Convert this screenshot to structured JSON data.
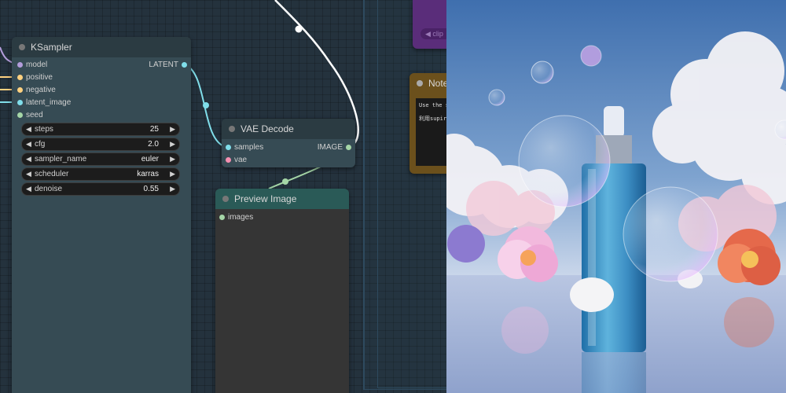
{
  "ksampler": {
    "title": "KSampler",
    "inputs": [
      "model",
      "positive",
      "negative",
      "latent_image",
      "seed"
    ],
    "output": "LATENT",
    "widgets": [
      {
        "label": "steps",
        "value": "25"
      },
      {
        "label": "cfg",
        "value": "2.0"
      },
      {
        "label": "sampler_name",
        "value": "euler"
      },
      {
        "label": "scheduler",
        "value": "karras"
      },
      {
        "label": "denoise",
        "value": "0.55"
      }
    ]
  },
  "vae_decode": {
    "title": "VAE Decode",
    "inputs": [
      "samples",
      "vae"
    ],
    "output": "IMAGE"
  },
  "preview": {
    "title": "Preview Image",
    "inputs": [
      "images"
    ]
  },
  "note": {
    "title": "Note",
    "line1": "Use the s",
    "line2": "利用supir"
  },
  "purple_node": {
    "label": "◀ clip"
  },
  "colors": {
    "model": "#b39ddb",
    "conditioning": "#ffd180",
    "latent": "#80deea",
    "image": "#a5d6a7",
    "vae": "#f48fb1",
    "note": "#7a5a1e",
    "purple": "#5a2d7a"
  }
}
